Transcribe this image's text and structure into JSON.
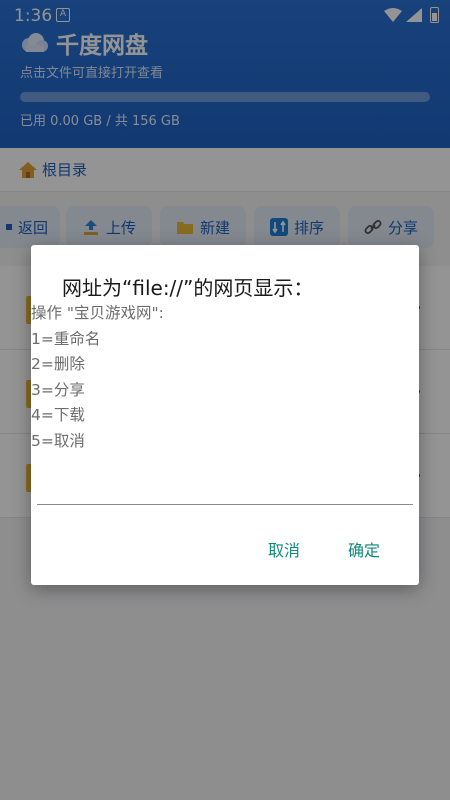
{
  "status_bar": {
    "time": "1:36",
    "notification_badge": "A"
  },
  "header": {
    "title": "千度网盘",
    "subtitle": "点击文件可直接打开查看",
    "storage_text": "已用 0.00 GB / 共 156 GB",
    "storage_used_fraction": 0.0
  },
  "breadcrumb": {
    "label": "根目录"
  },
  "toolbar": {
    "back": "返回",
    "upload": "上传",
    "new": "新建",
    "sort": "排序",
    "share": "分享"
  },
  "dialog": {
    "title": "网址为“file://”的网页显示：",
    "message": "操作 \"宝贝游戏网\":\n1=重命名\n2=删除\n3=分享\n4=下载\n5=取消",
    "input_value": "",
    "cancel_label": "取消",
    "ok_label": "确定"
  },
  "colors": {
    "header_blue": "#1f62c4",
    "accent_teal": "#0f8a7a"
  }
}
